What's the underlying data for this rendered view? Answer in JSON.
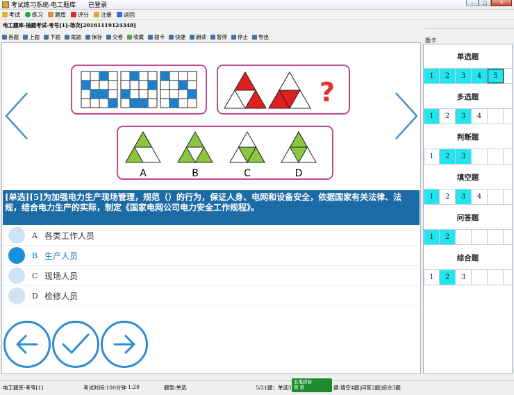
{
  "window": {
    "title": "考试练习系统-电工题库",
    "login_status": "已登录"
  },
  "menubar": {
    "items": [
      {
        "label": "考试",
        "color": "#e3b22f"
      },
      {
        "label": "练习",
        "color": "#2aa43a"
      },
      {
        "label": "题库",
        "color": "#d8943a"
      },
      {
        "label": "评分",
        "color": "#cc3333"
      },
      {
        "label": "注册",
        "color": "#d9a93a"
      },
      {
        "label": "返回",
        "color": "#3a6fc2"
      }
    ]
  },
  "breadcrumb": "电工题库-抽题考试-考号[1]-场次[20161119124348]",
  "toolbar": {
    "items": [
      "首题",
      "上题",
      "下题",
      "尾题",
      "保存",
      "交卷",
      "收藏",
      "题卡",
      "快捷",
      "朗读",
      "暂停",
      "停止",
      "导出"
    ]
  },
  "question": {
    "text": "[单选][5]为加强电力生产现场管理，规范（）的行为，保证人身、电网和设备安全，依据国家有关法律、法规，结合电力生产的实际，制定《国家电网公司电力安全工作规程》。",
    "image_labels": [
      "A",
      "B",
      "C",
      "D"
    ],
    "image_mark": "?"
  },
  "options": [
    {
      "letter": "A",
      "text": "各类工作人员"
    },
    {
      "letter": "B",
      "text": "生产人员"
    },
    {
      "letter": "C",
      "text": "现场人员"
    },
    {
      "letter": "D",
      "text": "检修人员"
    }
  ],
  "selected_option": "B",
  "side_panel": {
    "title": "题卡",
    "categories": [
      {
        "name": "单选题",
        "cells": [
          "1",
          "2",
          "3",
          "4",
          "5"
        ]
      },
      {
        "name": "多选题",
        "cells": [
          "1",
          "2",
          "3",
          "4"
        ]
      },
      {
        "name": "判断题",
        "cells": [
          "1",
          "2",
          "3"
        ]
      },
      {
        "name": "填空题",
        "cells": [
          "1",
          "2",
          "3",
          "4"
        ]
      },
      {
        "name": "问答题",
        "cells": [
          "1",
          "2"
        ]
      },
      {
        "name": "综合题",
        "cells": [
          "1",
          "2",
          "3"
        ]
      }
    ]
  },
  "statusbar": {
    "exam_id": "电工题库-考号[1]",
    "time": "考试时间:100分钟",
    "elapsed": "1:28",
    "qtype": "题型:单选",
    "summary": "5/21题：单选5",
    "summary_rest": "题:填空4题|问答2题|综合3题"
  },
  "ime": {
    "line1": "五笔拼音",
    "line2": "简 滚"
  },
  "colors": {
    "accent_blue": "#1c6aa6",
    "answered_cyan": "#22e5f0",
    "selected_dot": "#1a8fdc",
    "unselected_dot": "#cfe3f4",
    "nav_arrow": "#4a90c8"
  }
}
